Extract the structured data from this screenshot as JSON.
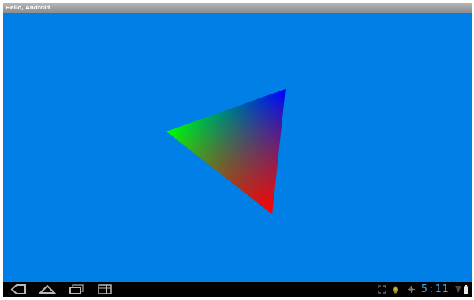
{
  "window": {
    "title": "Hello, Android"
  },
  "gl_view": {
    "background_color": "#0080e6",
    "shape": "triangle",
    "vertex_colors": [
      "#00ff00",
      "#0000ff",
      "#ff0000"
    ]
  },
  "navigation_bar": {
    "buttons": [
      "back-icon",
      "home-icon",
      "recent-apps-icon",
      "menu-icon"
    ]
  },
  "status_bar": {
    "icons": [
      "screenshot-icon",
      "android-debug-icon",
      "usb-icon",
      "signal-icon",
      "battery-icon"
    ],
    "time": "5:11",
    "accent_color": "#3fa9e8"
  }
}
